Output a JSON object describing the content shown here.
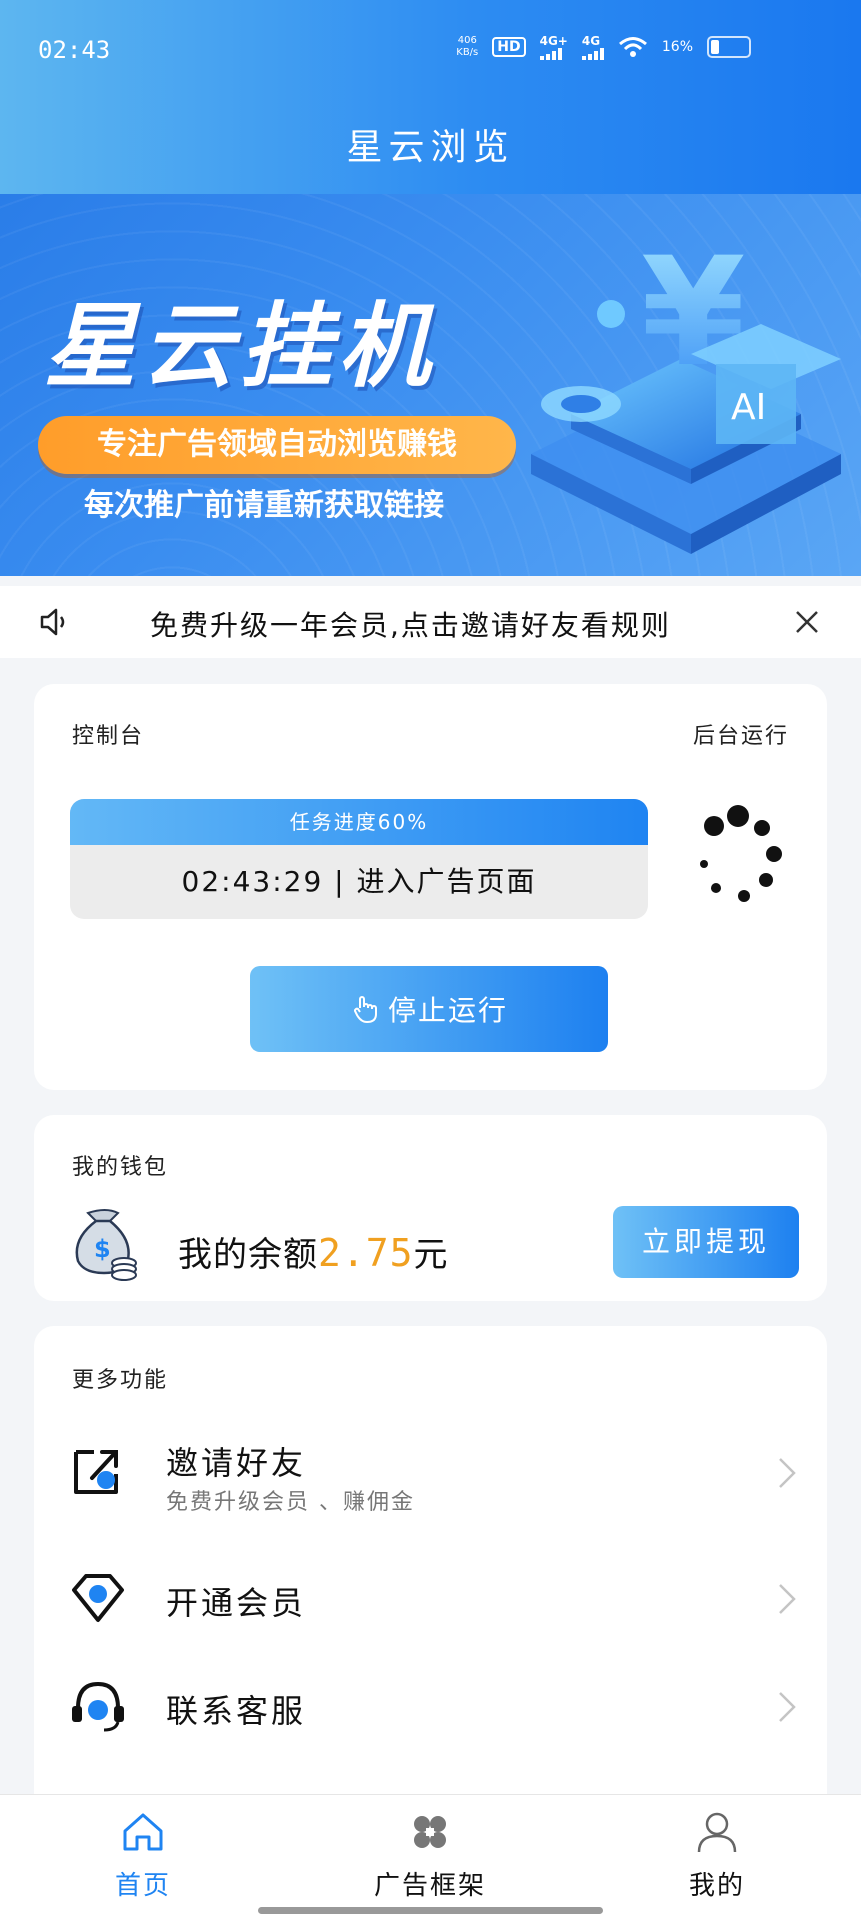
{
  "status_bar": {
    "time": "02:43",
    "net_speed_value": "406",
    "net_speed_unit": "KB/s",
    "hd_badge": "HD",
    "signal1": "4G+",
    "signal2": "4G",
    "battery": "16%"
  },
  "header": {
    "title": "星云浏览"
  },
  "banner": {
    "title": "星云挂机",
    "line1": "专注广告领域自动浏览赚钱",
    "line2": "每次推广前请重新获取链接"
  },
  "notice": {
    "text": "免费升级一年会员,点击邀请好友看规则"
  },
  "console": {
    "title": "控制台",
    "background_run": "后台运行",
    "progress_label": "任务进度60%",
    "progress_value": 0.6,
    "status_line": "02:43:29 | 进入广告页面",
    "stop_button": "停止运行"
  },
  "wallet": {
    "title": "我的钱包",
    "balance_prefix": "我的余额",
    "balance_amount": "2.75",
    "balance_unit": "元",
    "withdraw_button": "立即提现"
  },
  "more": {
    "title": "更多功能",
    "items": [
      {
        "label": "邀请好友",
        "sub": "免费升级会员 、赚佣金",
        "icon": "share-icon"
      },
      {
        "label": "开通会员",
        "sub": "",
        "icon": "diamond-icon"
      },
      {
        "label": "联系客服",
        "sub": "",
        "icon": "headset-icon"
      }
    ]
  },
  "tabbar": {
    "items": [
      {
        "label": "首页",
        "icon": "home-icon",
        "active": true
      },
      {
        "label": "广告框架",
        "icon": "grid-icon",
        "active": false
      },
      {
        "label": "我的",
        "icon": "user-icon",
        "active": false
      }
    ]
  },
  "colors": {
    "accent": "#1f84f2",
    "balance": "#f0a020",
    "pill": "#ff9d2a"
  }
}
